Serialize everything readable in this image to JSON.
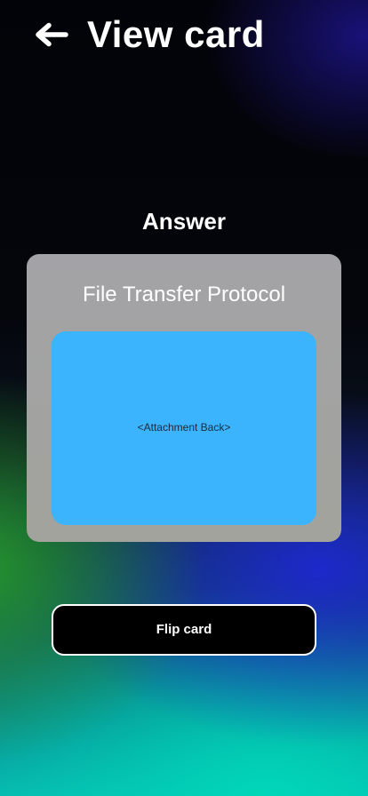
{
  "header": {
    "back_icon": "arrow-left-icon",
    "title": "View card"
  },
  "card": {
    "side_label": "Answer",
    "text": "File Transfer Protocol",
    "attachment_label": "<Attachment Back>"
  },
  "actions": {
    "flip_label": "Flip card"
  },
  "colors": {
    "card_background": "#a3a3a3",
    "attachment_background": "#3bb4fd",
    "button_background": "#000000",
    "button_border": "#ffffff"
  }
}
